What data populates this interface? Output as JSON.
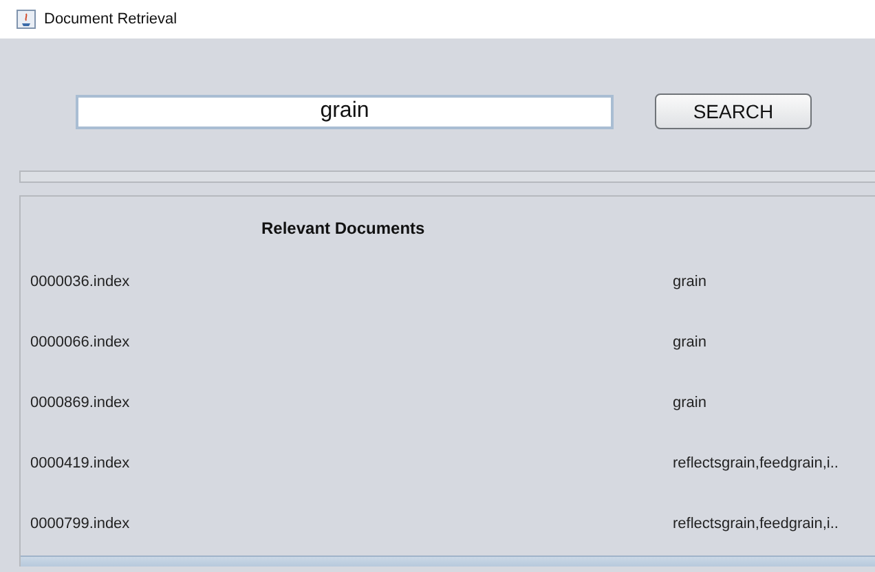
{
  "window": {
    "title": "Document Retrieval"
  },
  "search": {
    "value": "grain",
    "button": "SEARCH"
  },
  "results": {
    "heading": "Relevant Documents",
    "rows": [
      {
        "document": "0000036.index",
        "terms": "grain"
      },
      {
        "document": "0000066.index",
        "terms": "grain"
      },
      {
        "document": "0000869.index",
        "terms": "grain"
      },
      {
        "document": "0000419.index",
        "terms": "reflectsgrain,feedgrain,i.."
      },
      {
        "document": "0000799.index",
        "terms": "reflectsgrain,feedgrain,i.."
      }
    ]
  }
}
